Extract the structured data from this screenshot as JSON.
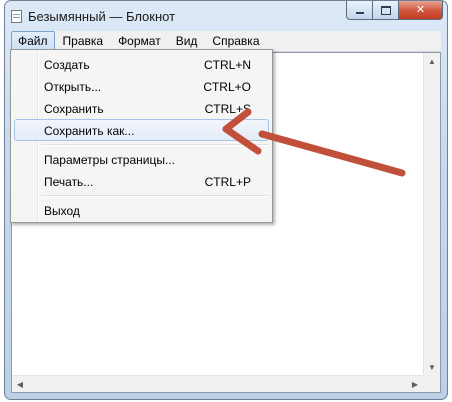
{
  "window": {
    "title": "Безымянный — Блокнот",
    "close_symbol": "✕"
  },
  "menubar": {
    "items": [
      {
        "label": "Файл"
      },
      {
        "label": "Правка"
      },
      {
        "label": "Формат"
      },
      {
        "label": "Вид"
      },
      {
        "label": "Справка"
      }
    ]
  },
  "file_menu": {
    "items": [
      {
        "label": "Создать",
        "shortcut": "CTRL+N"
      },
      {
        "label": "Открыть...",
        "shortcut": "CTRL+O"
      },
      {
        "label": "Сохранить",
        "shortcut": "CTRL+S"
      },
      {
        "label": "Сохранить как...",
        "shortcut": ""
      },
      {
        "label": "Параметры страницы...",
        "shortcut": ""
      },
      {
        "label": "Печать...",
        "shortcut": "CTRL+P"
      },
      {
        "label": "Выход",
        "shortcut": ""
      }
    ]
  },
  "colors": {
    "annotation_arrow": "#c0503a",
    "menu_highlight": "#cde0f6"
  },
  "icons": {
    "app": "notepad-icon",
    "scroll_up": "▲",
    "scroll_down": "▼",
    "scroll_left": "◀",
    "scroll_right": "▶"
  }
}
